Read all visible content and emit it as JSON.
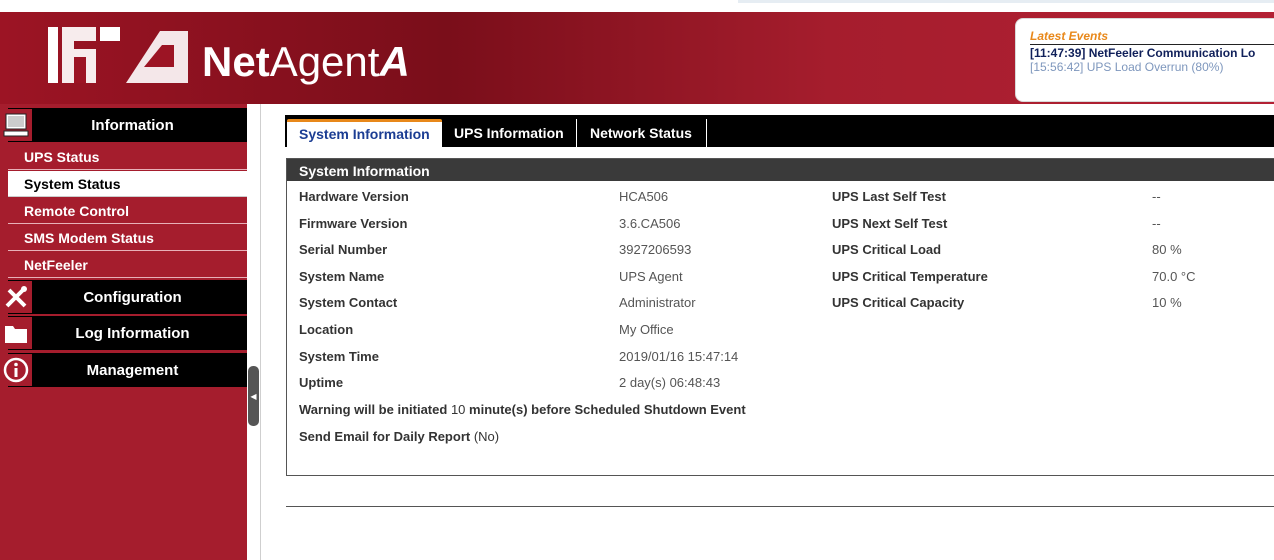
{
  "header": {
    "brand_prefix": "Net",
    "brand_middle": "Agent",
    "brand_suffix": "A",
    "events": {
      "title": "Latest Events",
      "items": [
        "[11:47:39] NetFeeler Communication Lo",
        "[15:56:42] UPS Load Overrun (80%)"
      ]
    }
  },
  "sidebar": {
    "information": "Information",
    "items": [
      "UPS Status",
      "System Status",
      "Remote Control",
      "SMS Modem Status",
      "NetFeeler"
    ],
    "configuration": "Configuration",
    "log_information": "Log Information",
    "management": "Management"
  },
  "tabs": [
    "System Information",
    "UPS Information",
    "Network Status"
  ],
  "panel": {
    "title": "System Information",
    "left": [
      {
        "label": "Hardware Version",
        "value": "HCA506"
      },
      {
        "label": "Firmware Version",
        "value": "3.6.CA506"
      },
      {
        "label": "Serial Number",
        "value": "3927206593"
      },
      {
        "label": "System Name",
        "value": "UPS Agent"
      },
      {
        "label": "System Contact",
        "value": "Administrator"
      },
      {
        "label": "Location",
        "value": "My Office"
      },
      {
        "label": "System Time",
        "value": "2019/01/16 15:47:14"
      },
      {
        "label": "Uptime",
        "value": "2 day(s) 06:48:43"
      }
    ],
    "right": [
      {
        "label": "UPS Last Self Test",
        "value": "--"
      },
      {
        "label": "UPS Next Self Test",
        "value": "--"
      },
      {
        "label": "UPS Critical Load",
        "value": "80 %"
      },
      {
        "label": "UPS Critical Temperature",
        "value": "70.0 °C"
      },
      {
        "label": "UPS Critical Capacity",
        "value": "10 %"
      }
    ],
    "warning": {
      "prefix": "Warning will be initiated",
      "value": "10",
      "suffix": "minute(s) before Scheduled Shutdown Event"
    },
    "email": {
      "prefix": "Send Email for Daily Report",
      "value": "(No)"
    }
  },
  "colors": {
    "brand": "#a51d2d",
    "accent": "#e8881a",
    "tab_active": "#1b3d93"
  },
  "icons": [
    "computer-icon",
    "tools-icon",
    "folder-icon",
    "info-icon",
    "collapse-handle-icon"
  ]
}
